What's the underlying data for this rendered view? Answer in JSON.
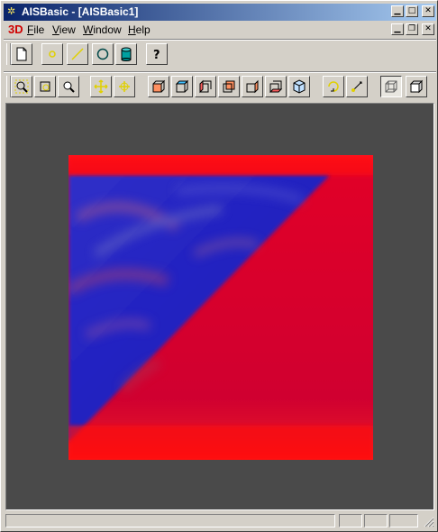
{
  "window": {
    "title": "AISBasic - [AISBasic1]"
  },
  "menu": {
    "logo": "3D",
    "items": [
      {
        "label": "File",
        "key": "F",
        "rest": "ile"
      },
      {
        "label": "View",
        "key": "V",
        "rest": "iew"
      },
      {
        "label": "Window",
        "key": "W",
        "rest": "indow"
      },
      {
        "label": "Help",
        "key": "H",
        "rest": "elp"
      }
    ]
  },
  "toolbar_top": [
    "new-document-icon",
    "point-icon",
    "line-icon",
    "circle-icon",
    "cylinder-icon",
    "help-icon"
  ],
  "toolbar_view": [
    "zoom-window-icon",
    "fit-all-icon",
    "zoom-icon",
    "pan-icon",
    "global-pan-icon",
    "front-view-icon",
    "top-view-icon",
    "left-view-icon",
    "back-view-icon",
    "right-view-icon",
    "bottom-view-icon",
    "axo-view-icon",
    "rotate-icon",
    "reset-icon",
    "wireframe-icon",
    "shading-icon"
  ],
  "colors": {
    "viewport_bg": "#4a4a4a",
    "shape_red": "#d80028",
    "shape_blue": "#1818c8",
    "titlebar_start": "#0a246a",
    "titlebar_end": "#a6caf0"
  }
}
